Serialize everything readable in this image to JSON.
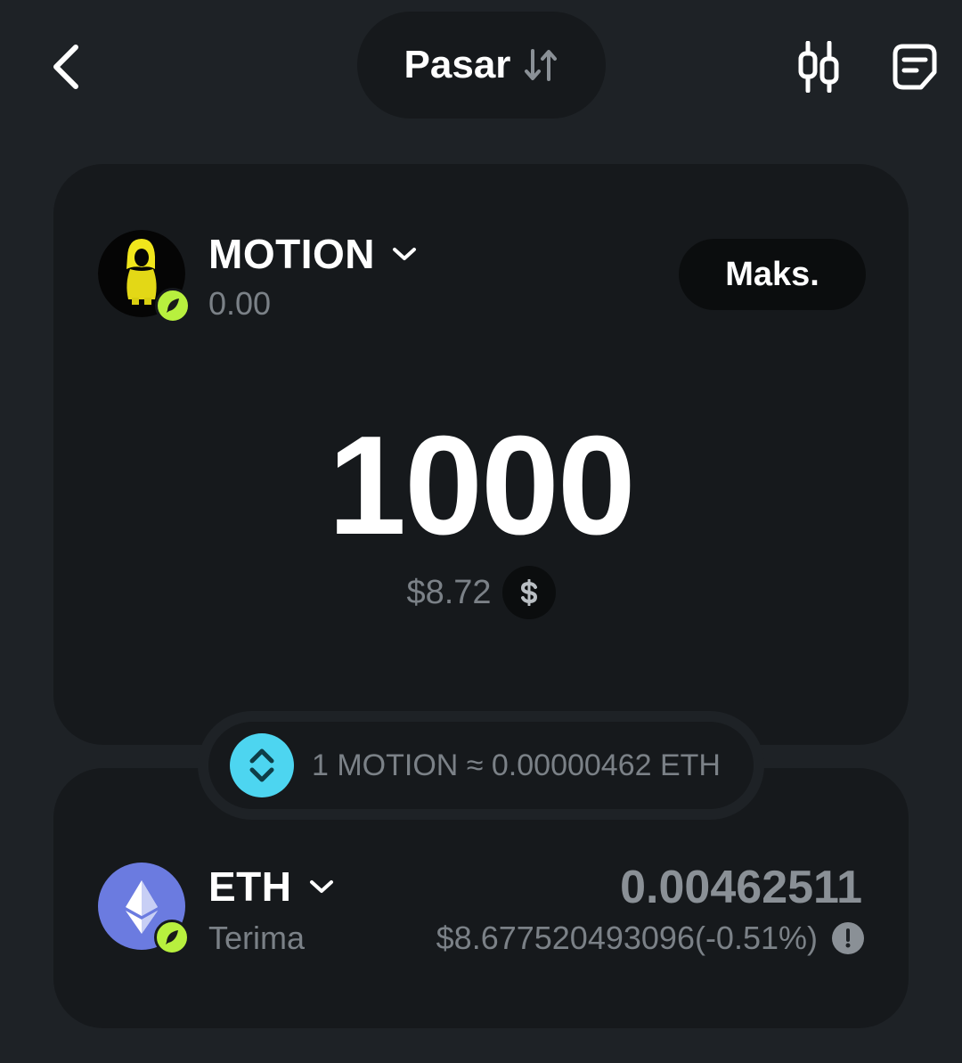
{
  "header": {
    "mode_label": "Pasar",
    "icons": [
      "back-arrow-icon",
      "sort-arrows-icon",
      "candlestick-chart-icon",
      "order-history-icon"
    ]
  },
  "from": {
    "symbol": "MOTION",
    "balance": "0.00",
    "max_label": "Maks.",
    "amount": "1000",
    "usd_value": "$8.72"
  },
  "rate": {
    "text": "1 MOTION ≈ 0.00000462 ETH"
  },
  "to": {
    "symbol": "ETH",
    "label": "Terima",
    "amount": "0.00462511",
    "usd_detail": "$8.677520493096(-0.51%)"
  },
  "colors": {
    "background": "#1e2226",
    "card": "#16191c",
    "accent_cyan": "#4dd5f0",
    "badge_green": "#b8f03e",
    "muted_text": "#7b8187",
    "eth_purple": "#6b7be0"
  }
}
